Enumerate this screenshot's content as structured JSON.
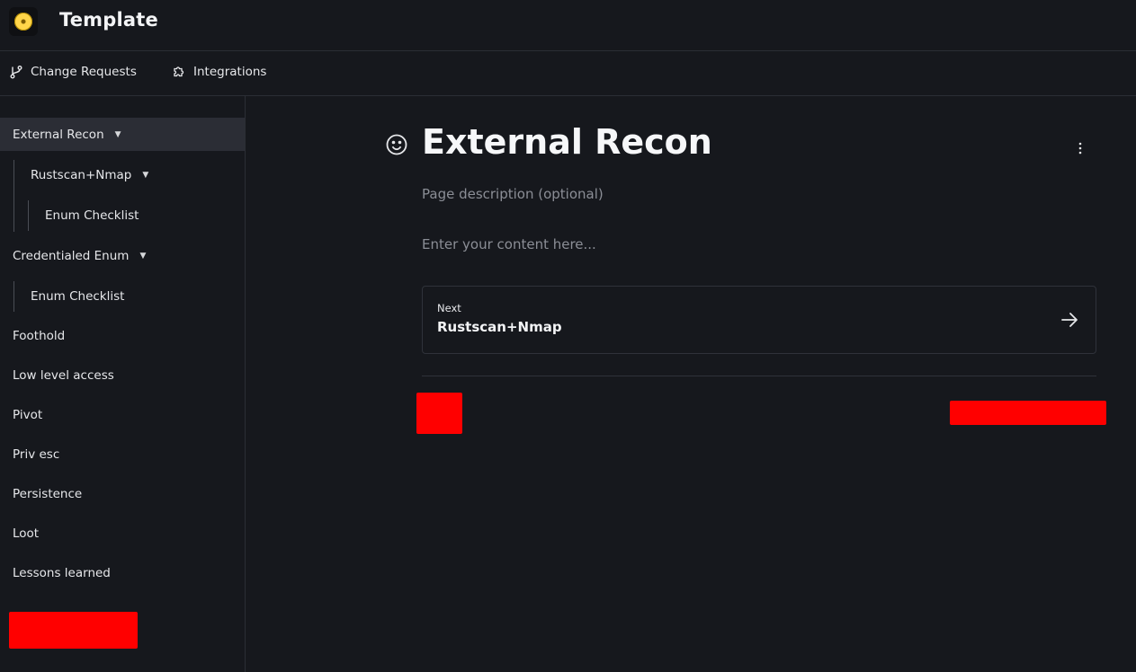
{
  "app": {
    "title": "Template"
  },
  "nav": {
    "change_requests": "Change Requests",
    "integrations": "Integrations"
  },
  "sidebar": {
    "items": [
      {
        "label": "External Recon",
        "active": true,
        "expanded": true
      },
      {
        "label": "Rustscan+Nmap",
        "expanded": true
      },
      {
        "label": "Enum Checklist"
      },
      {
        "label": "Credentialed Enum",
        "expanded": true
      },
      {
        "label": "Enum Checklist"
      },
      {
        "label": "Foothold"
      },
      {
        "label": "Low level access"
      },
      {
        "label": "Pivot"
      },
      {
        "label": "Priv esc"
      },
      {
        "label": "Persistence"
      },
      {
        "label": "Loot"
      },
      {
        "label": "Lessons learned"
      }
    ]
  },
  "page": {
    "icon": "smiley-icon",
    "title": "External Recon",
    "description_placeholder": "Page description (optional)",
    "content_placeholder": "Enter your content here...",
    "next": {
      "label": "Next",
      "title": "Rustscan+Nmap"
    }
  },
  "colors": {
    "background": "#16181d",
    "active_item": "#2b2d35",
    "border": "#2b2e35",
    "redaction": "#ff0000"
  }
}
